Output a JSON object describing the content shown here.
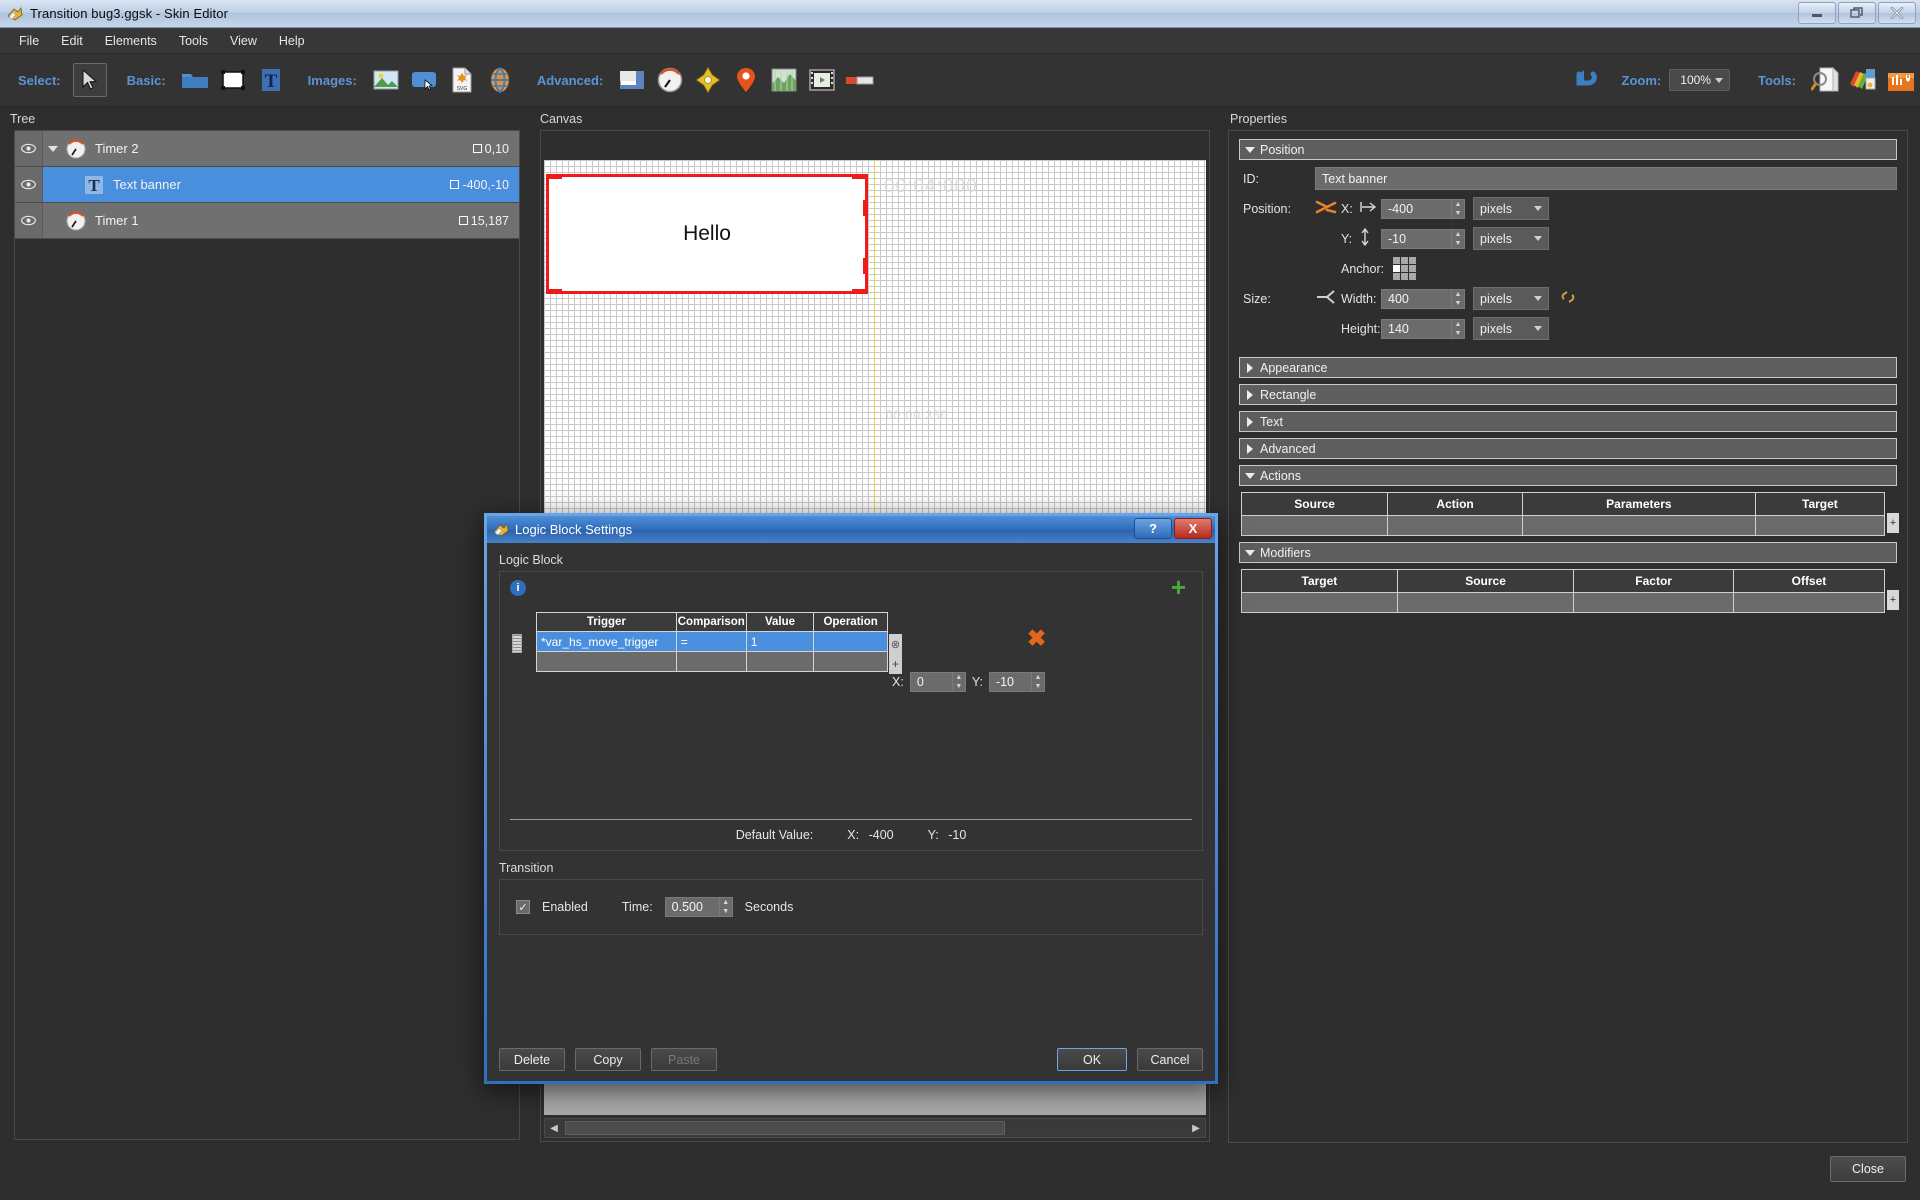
{
  "window": {
    "title": "Transition bug3.ggsk - Skin Editor",
    "minimize": "–",
    "restore": "❐",
    "close": "✕"
  },
  "menu": [
    "File",
    "Edit",
    "Elements",
    "Tools",
    "View",
    "Help"
  ],
  "toolbar": {
    "select_label": "Select:",
    "basic_label": "Basic:",
    "images_label": "Images:",
    "advanced_label": "Advanced:",
    "zoom_label": "Zoom:",
    "zoom_value": "100%",
    "tools_label": "Tools:",
    "icons": {
      "select": "cursor-arrow-icon",
      "basic": [
        "folder-icon",
        "rectangle-icon",
        "text-icon"
      ],
      "images": [
        "image-icon",
        "rounded-button-icon",
        "svg-file-icon",
        "globe-icon"
      ],
      "advanced": [
        "window-icon",
        "gauge-icon",
        "compass-icon",
        "map-pin-icon",
        "map-icon",
        "video-icon",
        "slider-icon"
      ],
      "undo": "undo-arrow-icon",
      "tools": [
        "magnifier-document-icon",
        "color-palette-icon",
        "toolbox-icon"
      ]
    }
  },
  "tree": {
    "title": "Tree",
    "rows": [
      {
        "label": "Timer 2",
        "coords": "0,10",
        "icon": "timer-icon",
        "expanded": true,
        "selected": false,
        "indent": 0
      },
      {
        "label": "Text banner",
        "coords": "-400,-10",
        "icon": "text-icon",
        "expanded": false,
        "selected": true,
        "indent": 1
      },
      {
        "label": "Timer 1",
        "coords": "15,187",
        "icon": "timer-icon",
        "expanded": false,
        "selected": false,
        "indent": 0
      }
    ]
  },
  "canvas": {
    "title": "Canvas",
    "banner_text": "Hello",
    "timer_big": "00:04:000",
    "timer_small": "00:00:350"
  },
  "properties": {
    "title": "Properties",
    "sections": [
      {
        "label": "Position",
        "expanded": true
      },
      {
        "label": "Appearance",
        "expanded": false
      },
      {
        "label": "Rectangle",
        "expanded": false
      },
      {
        "label": "Text",
        "expanded": false
      },
      {
        "label": "Advanced",
        "expanded": false
      },
      {
        "label": "Actions",
        "expanded": true
      },
      {
        "label": "Modifiers",
        "expanded": true
      }
    ],
    "id_label": "ID:",
    "id_value": "Text banner",
    "position_label": "Position:",
    "x_label": "X:",
    "x_value": "-400",
    "x_units": "pixels",
    "y_label": "Y:",
    "y_value": "-10",
    "y_units": "pixels",
    "anchor_label": "Anchor:",
    "size_label": "Size:",
    "width_label": "Width:",
    "width_value": "400",
    "width_units": "pixels",
    "height_label": "Height:",
    "height_value": "140",
    "height_units": "pixels",
    "actions_columns": [
      "Source",
      "Action",
      "Parameters",
      "Target"
    ],
    "modifiers_columns": [
      "Target",
      "Source",
      "Factor",
      "Offset"
    ],
    "add_symbol": "+"
  },
  "dialog": {
    "title": "Logic Block Settings",
    "help_button": "?",
    "close_button": "X",
    "logic_block_label": "Logic Block",
    "info_icon": "info-icon",
    "add_icon": "plus-green-icon",
    "delete_icon": "delete-x-icon",
    "table": {
      "columns": [
        "Trigger",
        "Comparison",
        "Value",
        "Operation"
      ],
      "rows": [
        {
          "trigger": "*var_hs_move_trigger",
          "comparison": "=",
          "value": "1",
          "operation": "",
          "selected": true
        },
        {
          "trigger": "",
          "comparison": "",
          "value": "",
          "operation": "",
          "selected": false
        }
      ],
      "clear_symbol": "⊗",
      "add_symbol": "+"
    },
    "xy": {
      "x_label": "X:",
      "x_value": "0",
      "y_label": "Y:",
      "y_value": "-10"
    },
    "default_value": {
      "label": "Default Value:",
      "x_label": "X:",
      "x_value": "-400",
      "y_label": "Y:",
      "y_value": "-10"
    },
    "transition": {
      "section_label": "Transition",
      "enabled_label": "Enabled",
      "enabled_checked": "✓",
      "time_label": "Time:",
      "time_value": "0.500",
      "seconds_label": "Seconds"
    },
    "buttons": {
      "delete": "Delete",
      "copy": "Copy",
      "paste": "Paste",
      "ok": "OK",
      "cancel": "Cancel"
    }
  },
  "bottom": {
    "close": "Close"
  },
  "colors": {
    "accent_blue": "#4a8ede",
    "label_blue": "#5b94d6",
    "selection_red": "#ee1b1b",
    "delete_orange": "#e2671c",
    "add_green": "#4aa83a"
  }
}
